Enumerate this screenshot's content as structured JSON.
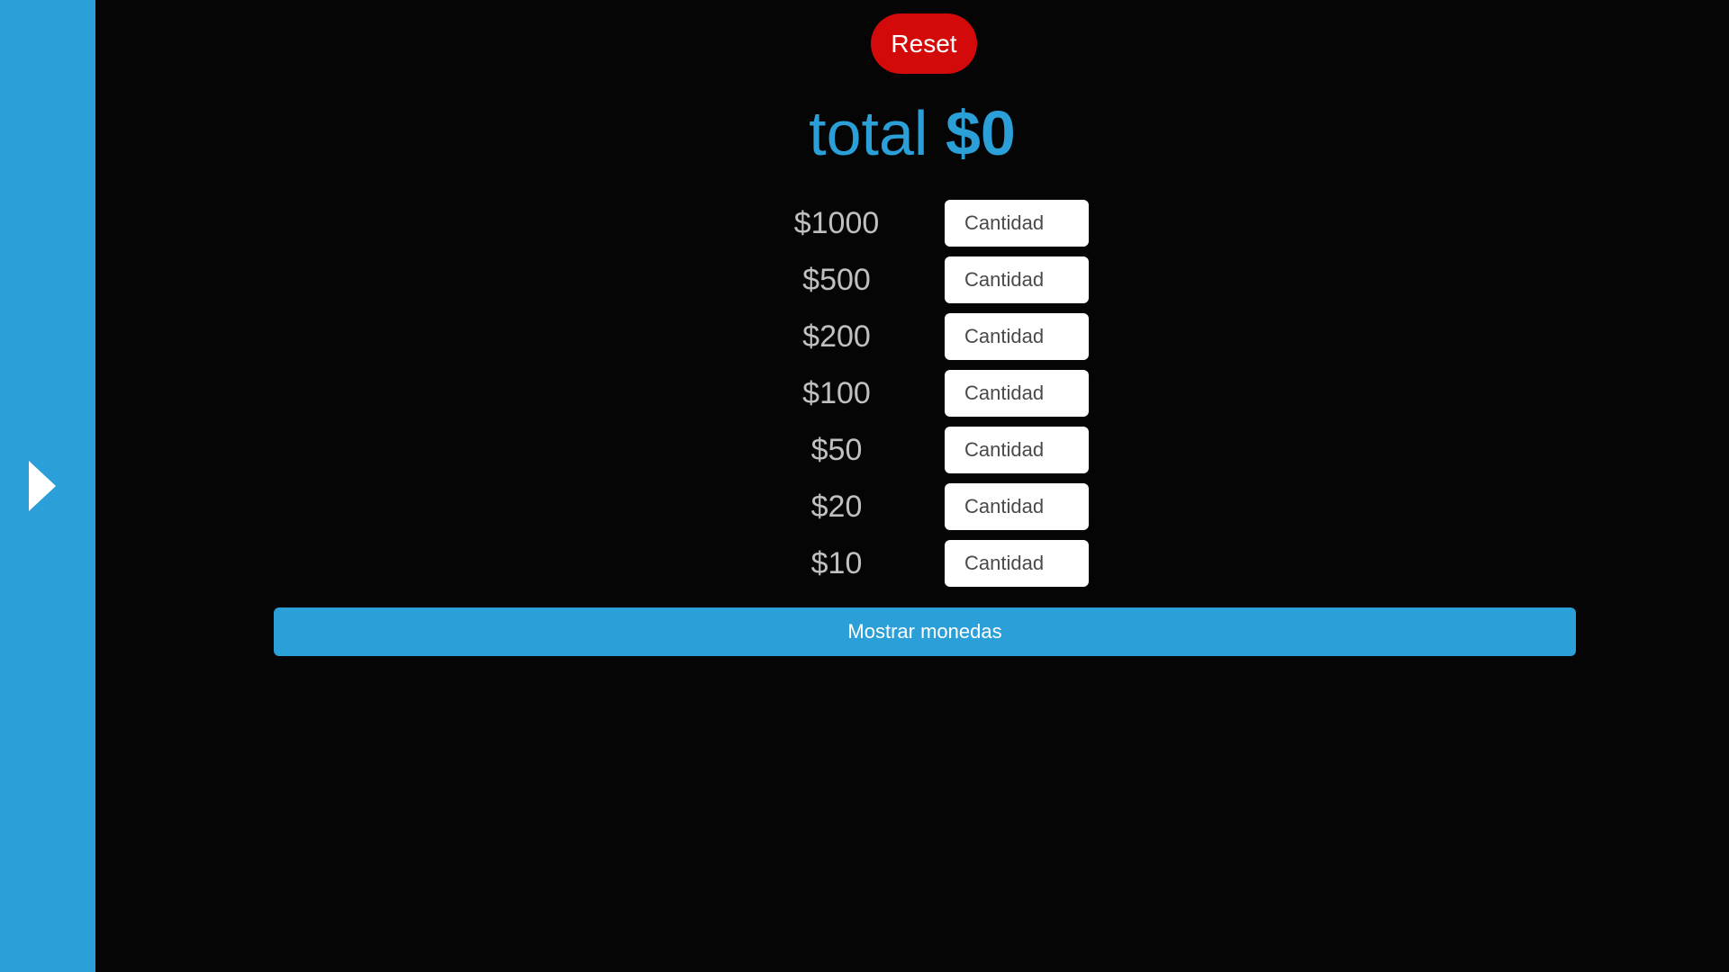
{
  "sidebar": {
    "toggle_icon": "play-triangle-icon",
    "color": "#2a9fd8"
  },
  "header": {
    "reset_label": "Reset",
    "reset_color": "#d40a0a"
  },
  "total": {
    "label": "total",
    "amount": "$0",
    "color": "#2a9fd8"
  },
  "denominations": [
    {
      "label": "$1000",
      "placeholder": "Cantidad",
      "value": ""
    },
    {
      "label": "$500",
      "placeholder": "Cantidad",
      "value": ""
    },
    {
      "label": "$200",
      "placeholder": "Cantidad",
      "value": ""
    },
    {
      "label": "$100",
      "placeholder": "Cantidad",
      "value": ""
    },
    {
      "label": "$50",
      "placeholder": "Cantidad",
      "value": ""
    },
    {
      "label": "$20",
      "placeholder": "Cantidad",
      "value": ""
    },
    {
      "label": "$10",
      "placeholder": "Cantidad",
      "value": ""
    }
  ],
  "actions": {
    "show_coins_label": "Mostrar monedas"
  }
}
